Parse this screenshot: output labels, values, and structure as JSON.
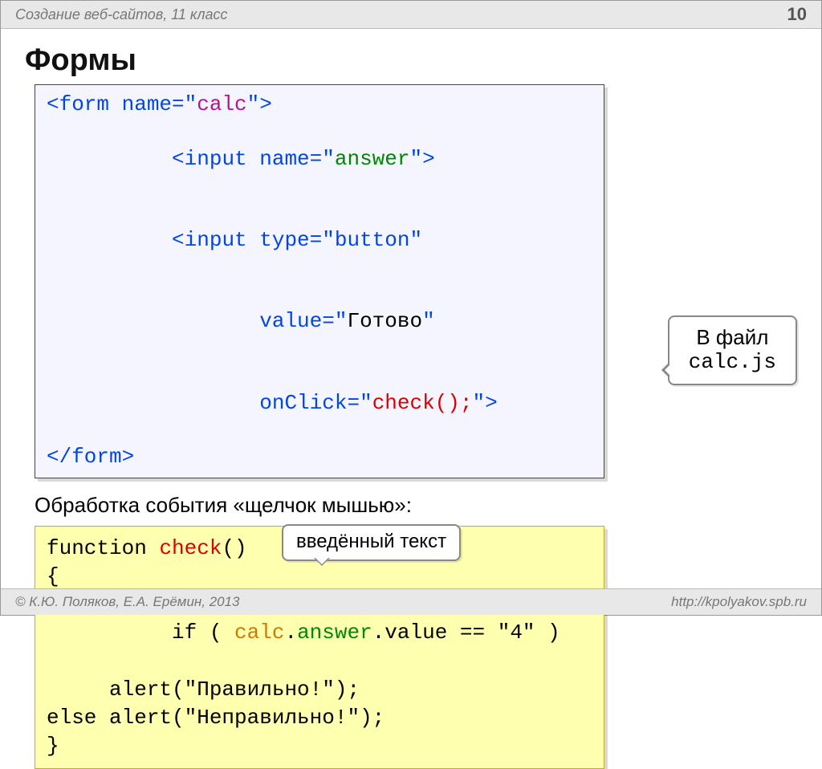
{
  "header": {
    "title": "Создание веб-сайтов, 11 класс",
    "pagenum": "10"
  },
  "title": "Формы",
  "code1": {
    "l1a": "<form name=\"",
    "l1b": "calc",
    "l1c": "\">",
    "l2a": "  <input name=\"",
    "l2b": "answer",
    "l2c": "\">",
    "l3": "  <input type=\"button\" ",
    "l4a": "         value=\"",
    "l4b": "Готово",
    "l4c": "\"",
    "l5a": "         onClick=\"",
    "l5b": "check();",
    "l5c": "\">",
    "l6": "</form>"
  },
  "subhead": "Обработка события «щелчок мышью»:",
  "bubble_small": "введённый текст",
  "bubble_right_line1": "В файл",
  "bubble_right_line2": "calc.js",
  "code2": {
    "l1a": "function ",
    "l1b": "check",
    "l1c": "()",
    "l2": "{",
    "l3a": "if ( ",
    "l3b": "calc",
    "l3c": ".",
    "l3d": "answer",
    "l3e": ".value == \"4\" )",
    "l4": "     alert(\"Правильно!\");",
    "l5": "else alert(\"Неправильно!\");",
    "l6": "}"
  },
  "footer": {
    "left": "© К.Ю. Поляков, Е.А. Ерёмин, 2013",
    "right": "http://kpolyakov.spb.ru"
  }
}
